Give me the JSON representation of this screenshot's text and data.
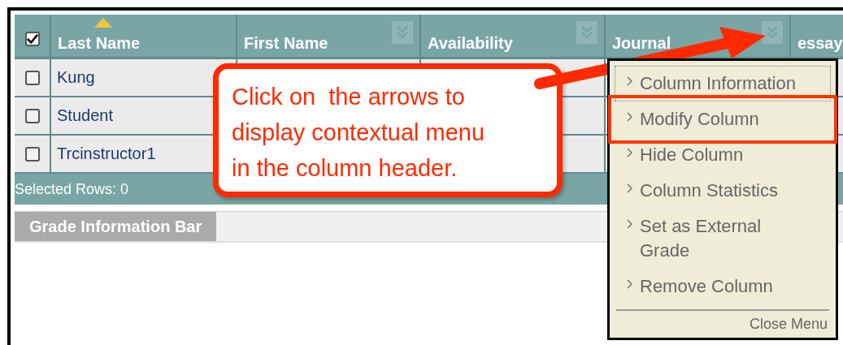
{
  "table": {
    "select_all": {
      "checked": true
    },
    "columns": [
      {
        "label": "Last Name",
        "sorted": true,
        "menu_button": false
      },
      {
        "label": "First Name",
        "sorted": false,
        "menu_button": true
      },
      {
        "label": "Availability",
        "sorted": false,
        "menu_button": true
      },
      {
        "label": "Journal",
        "sorted": false,
        "menu_button": true
      },
      {
        "label": "essay",
        "sorted": false,
        "menu_button": false
      }
    ],
    "rows": [
      {
        "last_name": "Kung",
        "checked": false
      },
      {
        "last_name": "Student",
        "checked": false
      },
      {
        "last_name": "Trcinstructor1",
        "checked": false
      }
    ],
    "footer": "Selected Rows: 0"
  },
  "grade_bar": {
    "tab": "Grade Information Bar"
  },
  "context_menu": {
    "items": [
      {
        "label": "Column Information",
        "focused": true,
        "highlighted": false
      },
      {
        "label": "Modify Column",
        "focused": false,
        "highlighted": true
      },
      {
        "label": "Hide Column",
        "focused": false,
        "highlighted": false
      },
      {
        "label": "Column Statistics",
        "focused": false,
        "highlighted": false
      },
      {
        "label": "Set as External Grade",
        "focused": false,
        "highlighted": false
      },
      {
        "label": "Remove Column",
        "focused": false,
        "highlighted": false
      }
    ],
    "close": "Close Menu"
  },
  "callout": {
    "lines": [
      "Click on  the arrows to",
      "display contextual menu",
      "in the column header."
    ]
  }
}
